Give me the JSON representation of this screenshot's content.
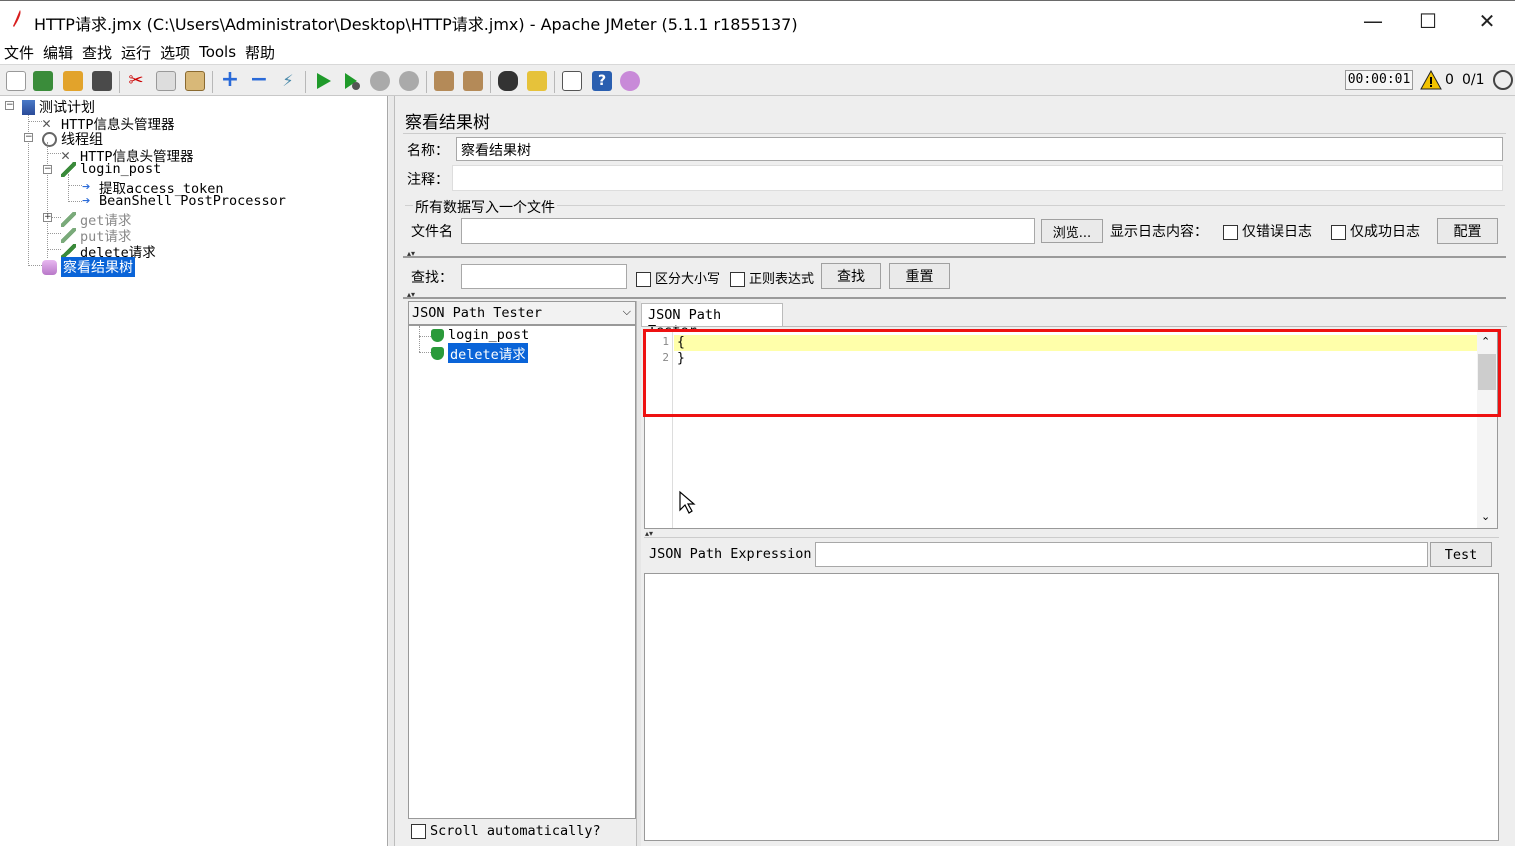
{
  "window": {
    "title": "HTTP请求.jmx (C:\\Users\\Administrator\\Desktop\\HTTP请求.jmx) - Apache JMeter (5.1.1 r1855137)",
    "minimize": "—",
    "maximize": "☐",
    "close": "✕"
  },
  "menu": [
    "文件",
    "编辑",
    "查找",
    "运行",
    "选项",
    "Tools",
    "帮助"
  ],
  "toolbar": {
    "timer": "00:00:01",
    "warning_count": "0",
    "threads": "0/1"
  },
  "tree": {
    "root": "测试计划",
    "header_manager": "HTTP信息头管理器",
    "thread_group": "线程组",
    "tg_header_manager": "HTTP信息头管理器",
    "login_post": "login_post",
    "extract_token": "提取access_token",
    "beanshell": "BeanShell PostProcessor",
    "get_req": "get请求",
    "put_req": "put请求",
    "delete_req": "delete请求",
    "result_tree": "察看结果树"
  },
  "panel": {
    "title": "察看结果树",
    "name_label": "名称：",
    "name_value": "察看结果树",
    "comment_label": "注释：",
    "write_all_label": "所有数据写入一个文件",
    "filename_label": "文件名",
    "browse_button": "浏览...",
    "log_display_label": "显示日志内容：",
    "errors_only_label": "仅错误日志",
    "success_only_label": "仅成功日志",
    "configure_button": "配置"
  },
  "search": {
    "label": "查找：",
    "case_sensitive_label": "区分大小写",
    "regex_label": "正则表达式",
    "find_button": "查找",
    "reset_button": "重置"
  },
  "results": {
    "renderer": "JSON Path Tester",
    "samples": [
      "login_post",
      "delete请求"
    ],
    "scroll_auto_label": "Scroll automatically?"
  },
  "tester": {
    "tab_label": "JSON Path Tester",
    "line_numbers": [
      "1",
      "2"
    ],
    "lines": [
      "{",
      "}"
    ],
    "expression_label": "JSON Path Expression",
    "test_button": "Test"
  },
  "colors": {
    "highlight": "#ffffaa",
    "selection": "#0a64d8",
    "annotation": "#ee1111"
  }
}
